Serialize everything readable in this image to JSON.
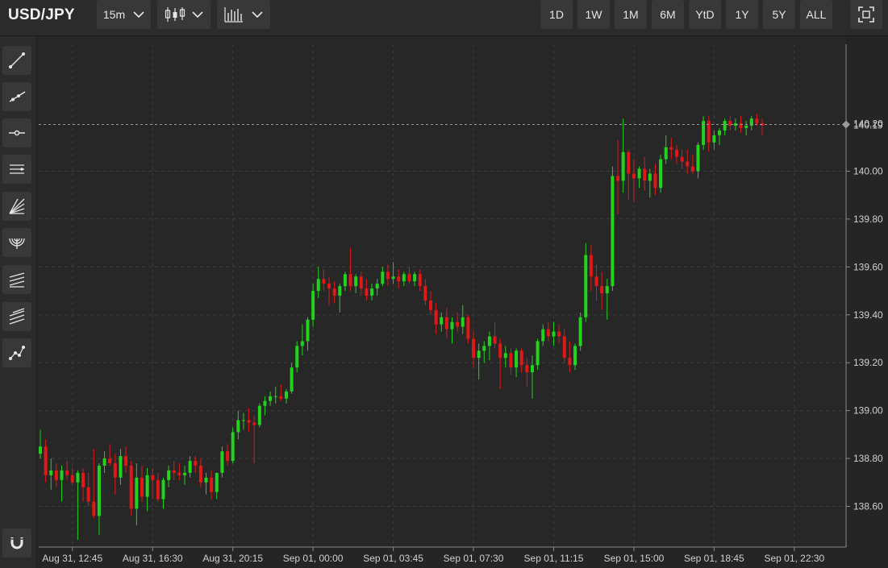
{
  "header": {
    "symbol": "USD/JPY",
    "interval": "15m",
    "chart_type_icon": "candlestick-icon",
    "indicators_icon": "bar-chart-icon",
    "ranges": [
      "1D",
      "1W",
      "1M",
      "6M",
      "YtD",
      "1Y",
      "5Y",
      "ALL"
    ],
    "fullscreen_icon": "fullscreen-icon"
  },
  "sidebar": {
    "tools": [
      "trend-line-icon",
      "ray-icon",
      "horizontal-line-icon",
      "parallel-channel-icon",
      "fan-icon",
      "arc-icon",
      "pitchfork-icon",
      "fibonacci-icon",
      "path-icon"
    ],
    "magnet_icon": "magnet-icon"
  },
  "colors": {
    "up": "#22d21c",
    "down": "#e01818",
    "background": "#252525",
    "grid": "#3d3d3d"
  },
  "chart_data": {
    "type": "candlestick",
    "ylim": [
      138.43,
      140.53
    ],
    "yticks": [
      138.6,
      138.8,
      139.0,
      139.2,
      139.4,
      139.6,
      139.8,
      140.0
    ],
    "ytick_labels": [
      "138.60",
      "138.80",
      "139.00",
      "139.20",
      "139.40",
      "139.60",
      "139.80",
      "140.00"
    ],
    "xtick_labels": [
      "Aug 31, 12:45",
      "Aug 31, 16:30",
      "Aug 31, 20:15",
      "Sep 01, 00:00",
      "Sep 01, 03:45",
      "Sep 01, 07:30",
      "Sep 01, 11:15",
      "Sep 01, 15:00",
      "Sep 01, 18:45",
      "Sep 01, 22:30"
    ],
    "xtick_index": [
      6,
      21,
      36,
      51,
      66,
      81,
      96,
      111,
      126,
      141
    ],
    "last_price_labels": [
      "140.20",
      "140.19"
    ],
    "last_price": 140.195,
    "grid": true,
    "candles": [
      [
        138.82,
        138.92,
        138.8,
        138.85
      ],
      [
        138.85,
        138.88,
        138.7,
        138.73
      ],
      [
        138.73,
        138.8,
        138.67,
        138.75
      ],
      [
        138.75,
        138.78,
        138.68,
        138.71
      ],
      [
        138.71,
        138.77,
        138.62,
        138.75
      ],
      [
        138.75,
        138.79,
        138.71,
        138.73
      ],
      [
        138.73,
        138.76,
        138.69,
        138.7
      ],
      [
        138.7,
        138.75,
        138.46,
        138.74
      ],
      [
        138.74,
        138.76,
        138.62,
        138.68
      ],
      [
        138.68,
        138.74,
        138.6,
        138.62
      ],
      [
        138.62,
        138.84,
        138.55,
        138.56
      ],
      [
        138.56,
        138.78,
        138.48,
        138.77
      ],
      [
        138.77,
        138.83,
        138.74,
        138.8
      ],
      [
        138.8,
        138.86,
        138.77,
        138.78
      ],
      [
        138.78,
        138.82,
        138.65,
        138.72
      ],
      [
        138.72,
        138.84,
        138.69,
        138.81
      ],
      [
        138.81,
        138.85,
        138.74,
        138.77
      ],
      [
        138.77,
        138.79,
        138.56,
        138.59
      ],
      [
        138.59,
        138.78,
        138.52,
        138.72
      ],
      [
        138.72,
        138.77,
        138.62,
        138.64
      ],
      [
        138.64,
        138.76,
        138.58,
        138.73
      ],
      [
        138.73,
        138.76,
        138.63,
        138.71
      ],
      [
        138.71,
        138.74,
        138.62,
        138.63
      ],
      [
        138.63,
        138.72,
        138.59,
        138.71
      ],
      [
        138.71,
        138.77,
        138.68,
        138.75
      ],
      [
        138.75,
        138.79,
        138.71,
        138.74
      ],
      [
        138.74,
        138.78,
        138.71,
        138.73
      ],
      [
        138.73,
        138.77,
        138.69,
        138.74
      ],
      [
        138.74,
        138.81,
        138.72,
        138.79
      ],
      [
        138.79,
        138.81,
        138.74,
        138.77
      ],
      [
        138.77,
        138.8,
        138.68,
        138.7
      ],
      [
        138.7,
        138.74,
        138.65,
        138.72
      ],
      [
        138.72,
        138.75,
        138.63,
        138.66
      ],
      [
        138.66,
        138.74,
        138.63,
        138.74
      ],
      [
        138.74,
        138.85,
        138.72,
        138.83
      ],
      [
        138.83,
        138.86,
        138.77,
        138.79
      ],
      [
        138.79,
        138.93,
        138.78,
        138.91
      ],
      [
        138.91,
        139.0,
        138.88,
        138.96
      ],
      [
        138.96,
        138.99,
        138.92,
        138.96
      ],
      [
        138.96,
        139.01,
        138.91,
        138.95
      ],
      [
        138.95,
        138.98,
        138.78,
        138.94
      ],
      [
        138.94,
        139.03,
        138.93,
        139.02
      ],
      [
        139.02,
        139.06,
        138.98,
        139.04
      ],
      [
        139.04,
        139.08,
        139.02,
        139.06
      ],
      [
        139.06,
        139.1,
        139.03,
        139.06
      ],
      [
        139.06,
        139.11,
        139.04,
        139.05
      ],
      [
        139.05,
        139.09,
        139.03,
        139.08
      ],
      [
        139.08,
        139.2,
        139.07,
        139.18
      ],
      [
        139.18,
        139.29,
        139.16,
        139.27
      ],
      [
        139.27,
        139.36,
        139.23,
        139.29
      ],
      [
        139.29,
        139.39,
        139.25,
        139.38
      ],
      [
        139.38,
        139.53,
        139.35,
        139.5
      ],
      [
        139.5,
        139.6,
        139.47,
        139.55
      ],
      [
        139.55,
        139.59,
        139.5,
        139.53
      ],
      [
        139.53,
        139.56,
        139.44,
        139.51
      ],
      [
        139.51,
        139.54,
        139.45,
        139.48
      ],
      [
        139.48,
        139.53,
        139.41,
        139.52
      ],
      [
        139.52,
        139.58,
        139.5,
        139.57
      ],
      [
        139.57,
        139.68,
        139.5,
        139.52
      ],
      [
        139.52,
        139.57,
        139.49,
        139.56
      ],
      [
        139.56,
        139.58,
        139.48,
        139.51
      ],
      [
        139.51,
        139.55,
        139.46,
        139.48
      ],
      [
        139.48,
        139.53,
        139.46,
        139.51
      ],
      [
        139.51,
        139.55,
        139.48,
        139.53
      ],
      [
        139.53,
        139.6,
        139.52,
        139.58
      ],
      [
        139.58,
        139.61,
        139.52,
        139.55
      ],
      [
        139.55,
        139.62,
        139.53,
        139.56
      ],
      [
        139.56,
        139.59,
        139.51,
        139.54
      ],
      [
        139.54,
        139.58,
        139.52,
        139.57
      ],
      [
        139.57,
        139.6,
        139.53,
        139.54
      ],
      [
        139.54,
        139.58,
        139.52,
        139.57
      ],
      [
        139.57,
        139.59,
        139.5,
        139.52
      ],
      [
        139.52,
        139.55,
        139.44,
        139.46
      ],
      [
        139.46,
        139.5,
        139.4,
        139.42
      ],
      [
        139.42,
        139.45,
        139.32,
        139.36
      ],
      [
        139.36,
        139.41,
        139.33,
        139.39
      ],
      [
        139.39,
        139.43,
        139.3,
        139.34
      ],
      [
        139.34,
        139.39,
        139.28,
        139.37
      ],
      [
        139.37,
        139.41,
        139.33,
        139.35
      ],
      [
        139.35,
        139.44,
        139.32,
        139.39
      ],
      [
        139.39,
        139.4,
        139.28,
        139.3
      ],
      [
        139.3,
        139.33,
        139.18,
        139.22
      ],
      [
        139.22,
        139.28,
        139.13,
        139.25
      ],
      [
        139.25,
        139.29,
        139.2,
        139.27
      ],
      [
        139.27,
        139.33,
        139.21,
        139.31
      ],
      [
        139.31,
        139.37,
        139.26,
        139.28
      ],
      [
        139.28,
        139.3,
        139.09,
        139.22
      ],
      [
        139.22,
        139.27,
        139.18,
        139.24
      ],
      [
        139.24,
        139.26,
        139.15,
        139.18
      ],
      [
        139.18,
        139.26,
        139.14,
        139.25
      ],
      [
        139.25,
        139.26,
        139.16,
        139.19
      ],
      [
        139.19,
        139.22,
        139.1,
        139.16
      ],
      [
        139.16,
        139.23,
        139.05,
        139.19
      ],
      [
        139.19,
        139.3,
        139.17,
        139.29
      ],
      [
        139.29,
        139.36,
        139.27,
        139.34
      ],
      [
        139.34,
        139.37,
        139.29,
        139.31
      ],
      [
        139.31,
        139.37,
        139.27,
        139.33
      ],
      [
        139.33,
        139.36,
        139.28,
        139.31
      ],
      [
        139.31,
        139.34,
        139.2,
        139.22
      ],
      [
        139.22,
        139.29,
        139.16,
        139.19
      ],
      [
        139.19,
        139.28,
        139.17,
        139.27
      ],
      [
        139.27,
        139.41,
        139.25,
        139.39
      ],
      [
        139.39,
        139.7,
        139.37,
        139.65
      ],
      [
        139.65,
        139.69,
        139.5,
        139.56
      ],
      [
        139.56,
        139.61,
        139.46,
        139.52
      ],
      [
        139.52,
        139.58,
        139.42,
        139.49
      ],
      [
        139.49,
        139.55,
        139.38,
        139.52
      ],
      [
        139.52,
        140.02,
        139.5,
        139.98
      ],
      [
        139.98,
        140.13,
        139.82,
        139.96
      ],
      [
        139.96,
        140.22,
        139.91,
        140.08
      ],
      [
        140.08,
        140.09,
        139.88,
        139.99
      ],
      [
        139.99,
        140.05,
        139.87,
        139.97
      ],
      [
        139.97,
        140.02,
        139.93,
        140.01
      ],
      [
        140.01,
        140.06,
        139.92,
        139.96
      ],
      [
        139.96,
        140.01,
        139.89,
        139.99
      ],
      [
        139.99,
        140.03,
        139.9,
        139.93
      ],
      [
        139.93,
        140.07,
        139.91,
        140.05
      ],
      [
        140.05,
        140.15,
        140.03,
        140.1
      ],
      [
        140.1,
        140.14,
        140.05,
        140.09
      ],
      [
        140.09,
        140.11,
        140.03,
        140.06
      ],
      [
        140.06,
        140.09,
        140.01,
        140.04
      ],
      [
        140.04,
        140.09,
        139.99,
        140.02
      ],
      [
        140.02,
        140.07,
        139.99,
        140.0
      ],
      [
        140.0,
        140.12,
        139.97,
        140.11
      ],
      [
        140.11,
        140.23,
        140.09,
        140.21
      ],
      [
        140.21,
        140.23,
        140.08,
        140.12
      ],
      [
        140.12,
        140.17,
        140.09,
        140.15
      ],
      [
        140.15,
        140.18,
        140.11,
        140.17
      ],
      [
        140.17,
        140.22,
        140.15,
        140.21
      ],
      [
        140.21,
        140.23,
        140.17,
        140.19
      ],
      [
        140.19,
        140.22,
        140.17,
        140.2
      ],
      [
        140.2,
        140.23,
        140.16,
        140.18
      ],
      [
        140.18,
        140.21,
        140.15,
        140.19
      ],
      [
        140.19,
        140.23,
        140.17,
        140.22
      ],
      [
        140.22,
        140.24,
        140.19,
        140.2
      ],
      [
        140.2,
        140.22,
        140.15,
        140.19
      ]
    ]
  }
}
